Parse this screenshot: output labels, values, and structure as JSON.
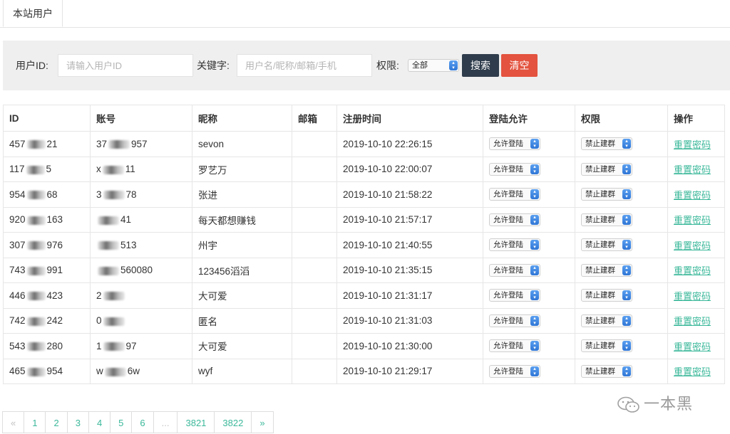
{
  "tabs": [
    {
      "label": "本站用户"
    }
  ],
  "search": {
    "user_id_label": "用户ID:",
    "user_id_placeholder": "请输入用户ID",
    "keyword_label": "关键字:",
    "keyword_placeholder": "用户名/昵称/邮箱/手机",
    "role_label": "权限:",
    "role_value": "全部",
    "search_button": "搜索",
    "clear_button": "清空"
  },
  "table": {
    "headers": [
      "ID",
      "账号",
      "昵称",
      "邮箱",
      "注册时间",
      "登陆允许",
      "权限",
      "操作"
    ],
    "rows": [
      {
        "id_pre": "457",
        "id_suf": "21",
        "acct_pre": "37",
        "acct_suf": "957",
        "nickname": "sevon",
        "email": "",
        "registered": "2019-10-10 22:26:15",
        "login": "允许登陆",
        "role": "禁止建群",
        "action": "重置密码"
      },
      {
        "id_pre": "117",
        "id_suf": "5",
        "acct_pre": "x",
        "acct_suf": "11",
        "nickname": "罗艺万",
        "email": "",
        "registered": "2019-10-10 22:00:07",
        "login": "允许登陆",
        "role": "禁止建群",
        "action": "重置密码"
      },
      {
        "id_pre": "954",
        "id_suf": "68",
        "acct_pre": "3",
        "acct_suf": "78",
        "nickname": "张进",
        "email": "",
        "registered": "2019-10-10 21:58:22",
        "login": "允许登陆",
        "role": "禁止建群",
        "action": "重置密码"
      },
      {
        "id_pre": "920",
        "id_suf": "163",
        "acct_pre": "",
        "acct_suf": "41",
        "nickname": "每天都想赚钱",
        "email": "",
        "registered": "2019-10-10 21:57:17",
        "login": "允许登陆",
        "role": "禁止建群",
        "action": "重置密码"
      },
      {
        "id_pre": "307",
        "id_suf": "976",
        "acct_pre": "",
        "acct_suf": "513",
        "nickname": "州宇",
        "email": "",
        "registered": "2019-10-10 21:40:55",
        "login": "允许登陆",
        "role": "禁止建群",
        "action": "重置密码"
      },
      {
        "id_pre": "743",
        "id_suf": "991",
        "acct_pre": "",
        "acct_suf": "560080",
        "nickname": "123456滔滔",
        "email": "",
        "registered": "2019-10-10 21:35:15",
        "login": "允许登陆",
        "role": "禁止建群",
        "action": "重置密码"
      },
      {
        "id_pre": "446",
        "id_suf": "423",
        "acct_pre": "2",
        "acct_suf": "",
        "nickname": "大可爱",
        "email": "",
        "registered": "2019-10-10 21:31:17",
        "login": "允许登陆",
        "role": "禁止建群",
        "action": "重置密码"
      },
      {
        "id_pre": "742",
        "id_suf": "242",
        "acct_pre": "0",
        "acct_suf": "",
        "nickname": "匿名",
        "email": "",
        "registered": "2019-10-10 21:31:03",
        "login": "允许登陆",
        "role": "禁止建群",
        "action": "重置密码"
      },
      {
        "id_pre": "543",
        "id_suf": "280",
        "acct_pre": "1",
        "acct_suf": "97",
        "nickname": "大可爱",
        "email": "",
        "registered": "2019-10-10 21:30:00",
        "login": "允许登陆",
        "role": "禁止建群",
        "action": "重置密码"
      },
      {
        "id_pre": "465",
        "id_suf": "954",
        "acct_pre": "w",
        "acct_suf": "6w",
        "nickname": "wyf",
        "email": "",
        "registered": "2019-10-10 21:29:17",
        "login": "允许登陆",
        "role": "禁止建群",
        "action": "重置密码"
      }
    ]
  },
  "pagination": {
    "prev": "«",
    "pages": [
      "1",
      "2",
      "3",
      "4",
      "5",
      "6"
    ],
    "ellipsis": "...",
    "last_pages": [
      "3821",
      "3822"
    ],
    "next": "»"
  },
  "watermark": {
    "text": "一本黑",
    "icon": "wechat-icon"
  },
  "colors": {
    "search_button_bg": "#2f3c4b",
    "clear_button_bg": "#e3533f",
    "link": "#3bb89a",
    "panel_bg": "#efefef"
  }
}
